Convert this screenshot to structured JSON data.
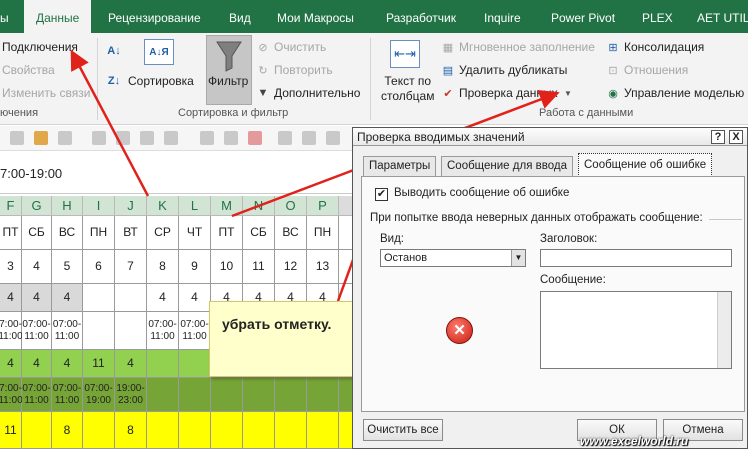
{
  "ribbon": {
    "tabs": [
      "ы",
      "Данные",
      "Рецензирование",
      "Вид",
      "Мои Макросы",
      "Разработчик",
      "Inquire",
      "Power Pivot",
      "PLEX",
      "AET UTILI"
    ],
    "active_tab": "Данные",
    "connections": {
      "items": [
        "Подключения",
        "Свойства",
        "Изменить связи"
      ],
      "group": "ючения"
    },
    "sort": {
      "sort_az": "А↓Я",
      "sort_label": "Сортировка",
      "filter_label": "Фильтр",
      "clear": "Очистить",
      "reapply": "Повторить",
      "advanced": "Дополнительно",
      "group": "Сортировка и фильтр"
    },
    "data_tools": {
      "text_to_columns": "Текст по\nстолбцам",
      "flash_fill": "Мгновенное заполнение",
      "remove_dupes": "Удалить дубликаты",
      "validation": "Проверка данных",
      "consolidate": "Консолидация",
      "relations": "Отношения",
      "data_model": "Управление моделью",
      "group": "Работа с данными"
    }
  },
  "formula_bar": {
    "value": "7:00-19:00"
  },
  "sheet": {
    "columns": [
      "F",
      "G",
      "H",
      "I",
      "J",
      "K",
      "L",
      "M",
      "N",
      "O",
      "P"
    ],
    "selected_columns": [
      "F",
      "G",
      "H",
      "I",
      "J",
      "K",
      "L",
      "M",
      "N",
      "O",
      "P"
    ],
    "rows": [
      [
        "ПТ",
        "СБ",
        "ВС",
        "ПН",
        "ВТ",
        "СР",
        "ЧТ",
        "ПТ",
        "СБ",
        "ВС",
        "ПН"
      ],
      [
        "3",
        "4",
        "5",
        "6",
        "7",
        "8",
        "9",
        "10",
        "11",
        "12",
        "13"
      ],
      [
        "4",
        "4",
        "4",
        "",
        "",
        "4",
        "4",
        "4",
        "4",
        "4",
        "4"
      ],
      [
        "7:00-\n11:00",
        "07:00-\n11:00",
        "07:00-\n11:00",
        "",
        "",
        "07:00-\n11:00",
        "07:00-\n11:00",
        "",
        "",
        "",
        ""
      ],
      [
        "4",
        "4",
        "4",
        "11",
        "4",
        "",
        "",
        "",
        "",
        "",
        ""
      ],
      [
        "7:00-\n11:00",
        "07:00-\n11:00",
        "07:00-\n11:00",
        "07:00-\n19:00",
        "19:00-\n23:00",
        "",
        "",
        "",
        "",
        "",
        ""
      ],
      [
        "11",
        "",
        "8",
        "",
        "8",
        "",
        "",
        "",
        "",
        "",
        ""
      ]
    ]
  },
  "callout": {
    "text": "убрать отметку."
  },
  "dialog": {
    "title": "Проверка вводимых значений",
    "help": "?",
    "close": "X",
    "tabs": [
      "Параметры",
      "Сообщение для ввода",
      "Сообщение об ошибке"
    ],
    "active_tab": "Сообщение об ошибке",
    "show_error_checked": true,
    "show_error_label": "Выводить сообщение об ошибке",
    "section_label": "При попытке ввода неверных данных отображать сообщение:",
    "style_label": "Вид:",
    "style_value": "Останов",
    "title_label": "Заголовок:",
    "title_value": "",
    "message_label": "Сообщение:",
    "message_value": "",
    "clear_all": "Очистить все",
    "ok": "ОК",
    "cancel": "Отмена"
  },
  "watermark": "www.excelworld.ru",
  "colors": {
    "accent": "#217346",
    "arrow": "#e0221b",
    "green_dark": "#76a436",
    "green_light": "#92d050",
    "yellow": "#ffff00",
    "gray": "#d9d9d9"
  }
}
